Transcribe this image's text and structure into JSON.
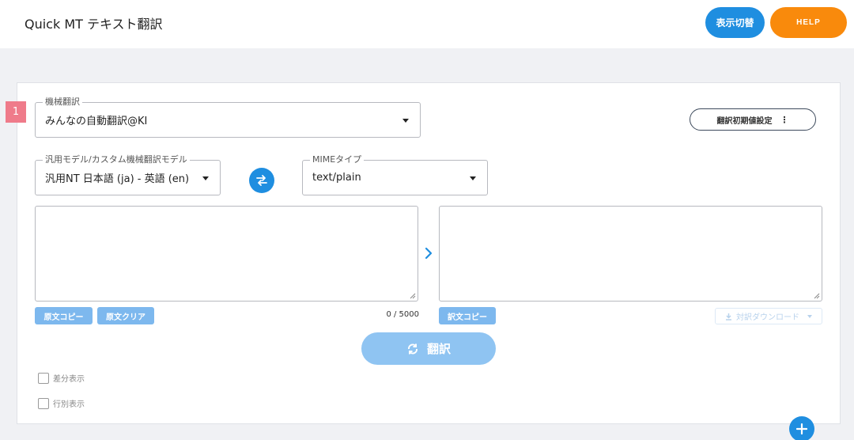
{
  "header": {
    "title": "Quick MT テキスト翻訳",
    "toggle_label": "表示切替",
    "help_label": "HELP"
  },
  "step": "1",
  "engine": {
    "label": "機械翻訳",
    "value": "みんなの自動翻訳@KI"
  },
  "defaults_button": "翻訳初期値設定",
  "model": {
    "label": "汎用モデル/カスタム機械翻訳モデル",
    "value": "汎用NT 日本語 (ja) - 英語 (en)"
  },
  "mime": {
    "label": "MIMEタイプ",
    "value": "text/plain"
  },
  "source": {
    "copy_label": "原文コピー",
    "clear_label": "原文クリア",
    "char_count": "0 / 5000"
  },
  "target": {
    "copy_label": "訳文コピー",
    "download_label": "対訳ダウンロード"
  },
  "translate_label": "翻訳",
  "options": {
    "diff_label": "差分表示",
    "line_label": "行別表示"
  },
  "colors": {
    "primary": "#1f8ee0",
    "help": "#f98a0c",
    "badge": "#ef7b8a",
    "disabled_primary": "#8fc4f2"
  }
}
